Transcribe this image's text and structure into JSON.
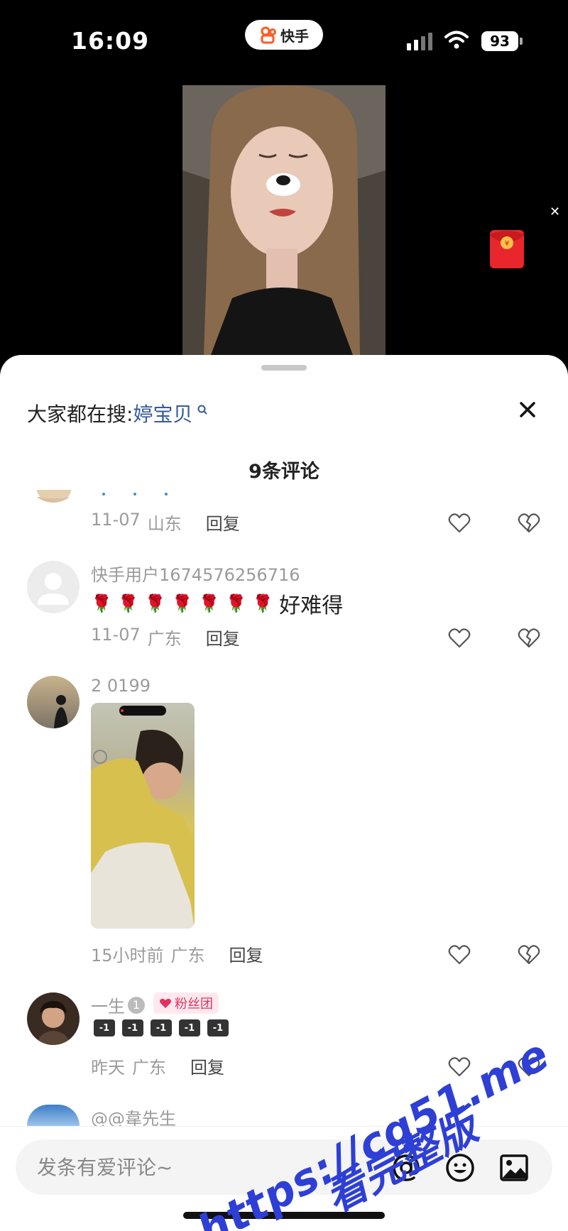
{
  "status_bar": {
    "time": "16:09",
    "app_name": "快手",
    "battery": "93"
  },
  "search_hint": {
    "prefix": "大家都在搜:",
    "keyword": "婷宝贝"
  },
  "comments_count": "9条评论",
  "comments": [
    {
      "meta": {
        "date": "11-07",
        "region": "山东",
        "reply": "回复"
      }
    },
    {
      "username": "快手用户1674576256716",
      "text": "好难得",
      "roses": [
        "🌹",
        "🌹",
        "🌹",
        "🌹",
        "🌹",
        "🌹",
        "🌹"
      ],
      "meta": {
        "date": "11-07",
        "region": "广东",
        "reply": "回复"
      }
    },
    {
      "username": "2 0199",
      "meta": {
        "date": "15小时前",
        "region": "广东",
        "reply": "回复"
      }
    },
    {
      "username": "一生",
      "level": "1",
      "fan_badge": "粉丝团",
      "mini_emojis": [
        "-1",
        "-1",
        "-1",
        "-1",
        "-1"
      ],
      "meta": {
        "date": "昨天",
        "region": "广东",
        "reply": "回复"
      }
    },
    {
      "username": "@@韋先生"
    }
  ],
  "input": {
    "placeholder": "发条有爱评论~"
  },
  "watermark": {
    "url": "https://cg51.me",
    "text": "看完整版"
  },
  "colors": {
    "keyword": "#355a9c",
    "fan_badge": "#e0335f",
    "watermark": "#2e3fd6"
  }
}
